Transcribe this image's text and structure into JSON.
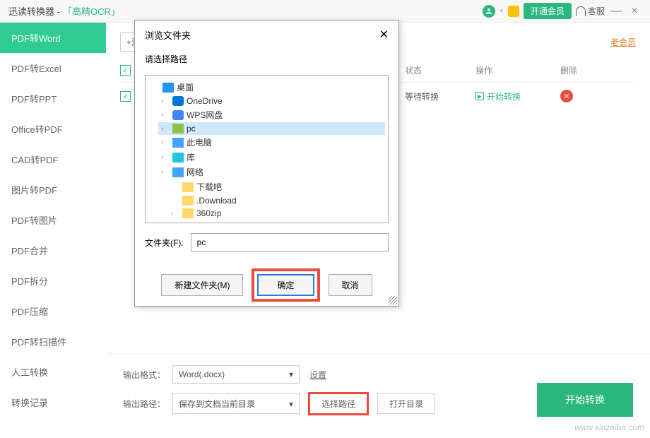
{
  "titlebar": {
    "app_name": "迅读转换器 - ",
    "ocr_label": "「高精OCR」",
    "vip_button": "开通会员",
    "service_label": "客服",
    "minimize": "—",
    "close": "×"
  },
  "sidebar": {
    "items": [
      "PDF转Word",
      "PDF转Excel",
      "PDF转PPT",
      "Office转PDF",
      "CAD转PDF",
      "图片转PDF",
      "PDF转图片",
      "PDF合并",
      "PDF拆分",
      "PDF压缩",
      "PDF转扫描件",
      "人工转换",
      "转换记录"
    ],
    "active_index": 0
  },
  "content": {
    "add_button": "+添",
    "old_member": "老会员",
    "headers": {
      "status": "状态",
      "action": "操作",
      "delete": "删除"
    },
    "row": {
      "status": "等待转换",
      "action": "开始转换"
    }
  },
  "bottom": {
    "format_label": "输出格式：",
    "format_value": "Word(.docx)",
    "settings": "设置",
    "path_label": "输出路径：",
    "path_value": "保存到文档当前目录",
    "select_path": "选择路径",
    "open_dir": "打开目录",
    "convert": "开始转换"
  },
  "dialog": {
    "title": "浏览文件夹",
    "prompt": "请选择路径",
    "tree": [
      {
        "label": "桌面",
        "icon": "icon-desktop",
        "indent": 0,
        "arrow": ""
      },
      {
        "label": "OneDrive",
        "icon": "icon-onedrive",
        "indent": 1,
        "arrow": "›"
      },
      {
        "label": "WPS网盘",
        "icon": "icon-wps",
        "indent": 1,
        "arrow": "›"
      },
      {
        "label": "pc",
        "icon": "icon-pc",
        "indent": 1,
        "arrow": "›",
        "selected": true
      },
      {
        "label": "此电脑",
        "icon": "icon-thispc",
        "indent": 1,
        "arrow": "›"
      },
      {
        "label": "库",
        "icon": "icon-lib",
        "indent": 1,
        "arrow": "›"
      },
      {
        "label": "网络",
        "icon": "icon-network",
        "indent": 1,
        "arrow": "›"
      },
      {
        "label": "下载吧",
        "icon": "folder-yellow",
        "indent": 2,
        "arrow": ""
      },
      {
        "label": ".Download",
        "icon": "folder-yellow",
        "indent": 2,
        "arrow": ""
      },
      {
        "label": "360zip",
        "icon": "folder-yellow",
        "indent": 2,
        "arrow": "›"
      }
    ],
    "folder_label": "文件夹(F):",
    "folder_value": "pc",
    "new_folder": "新建文件夹(M)",
    "ok": "确定",
    "cancel": "取消"
  },
  "watermark": "www.xiazaiba.com"
}
